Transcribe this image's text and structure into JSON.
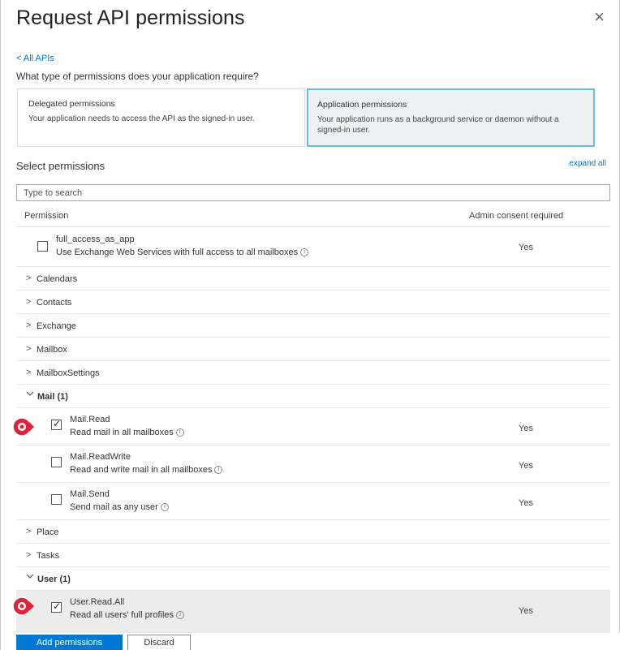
{
  "panel": {
    "title": "Request API permissions",
    "close_glyph": "×",
    "back_link": "< All APIs",
    "question": "What type of permissions does your application require?"
  },
  "permission_types": {
    "delegated": {
      "title": "Delegated permissions",
      "description": "Your application needs to access the API as the signed-in user."
    },
    "application": {
      "title": "Application permissions",
      "description": "Your application runs as a background service or daemon without a signed-in user."
    }
  },
  "select": {
    "label": "Select permissions",
    "expand_all": "expand all",
    "search_placeholder": "Type to search"
  },
  "table": {
    "col_permission": "Permission",
    "col_admin": "Admin consent required"
  },
  "top_permission": {
    "name": "full_access_as_app",
    "description": "Use Exchange Web Services with full access to all mailboxes",
    "admin": "Yes",
    "checked": false
  },
  "groups": {
    "calendars": "Calendars",
    "contacts": "Contacts",
    "exchange": "Exchange",
    "mailbox": "Mailbox",
    "mailbox_settings": "MailboxSettings",
    "mail": "Mail (1)",
    "place": "Place",
    "tasks": "Tasks",
    "user": "User (1)"
  },
  "mail_permissions": [
    {
      "name": "Mail.Read",
      "description": "Read mail in all mailboxes",
      "admin": "Yes",
      "checked": true
    },
    {
      "name": "Mail.ReadWrite",
      "description": "Read and write mail in all mailboxes",
      "admin": "Yes",
      "checked": false
    },
    {
      "name": "Mail.Send",
      "description": "Send mail as any user",
      "admin": "Yes",
      "checked": false
    }
  ],
  "user_permissions": [
    {
      "name": "User.Read.All",
      "description": "Read all users' full profiles",
      "admin": "Yes",
      "checked": true
    }
  ],
  "footer": {
    "add_button": "Add permissions",
    "discard_button": "Discard"
  },
  "icons": {
    "close": "close-icon",
    "chevron_right": "chevron-right-icon",
    "chevron_down": "chevron-down-icon",
    "info": "info-icon",
    "marker": "highlight-marker-icon"
  },
  "colors": {
    "accent": "#0078d4",
    "selected_border": "#6cb8e6",
    "marker": "#d9263f"
  }
}
